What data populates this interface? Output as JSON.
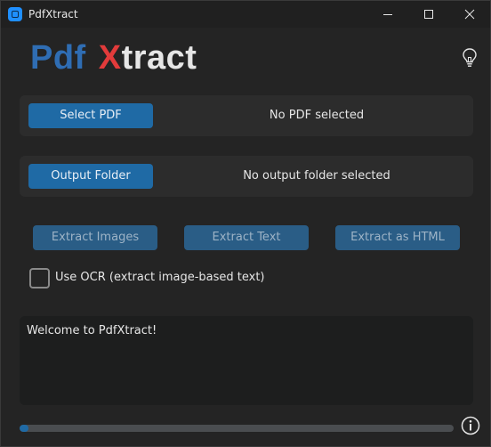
{
  "window": {
    "title": "PdfXtract"
  },
  "logo": {
    "part1": "Pdf",
    "part2": "X",
    "part3": "tract"
  },
  "pdf_row": {
    "button_label": "Select PDF",
    "status": "No PDF selected"
  },
  "output_row": {
    "button_label": "Output Folder",
    "status": "No output folder selected"
  },
  "actions": {
    "extract_images": "Extract Images",
    "extract_text": "Extract Text",
    "extract_html": "Extract as HTML"
  },
  "ocr": {
    "label": "Use OCR (extract image-based text)",
    "checked": false
  },
  "log": {
    "text": "Welcome to PdfXtract!"
  },
  "progress": {
    "value": 0.02
  },
  "icons": {
    "app": "app-icon",
    "theme": "lightbulb-icon",
    "about": "info-icon"
  },
  "colors": {
    "accent": "#1f6aa5",
    "logo_pdf": "#2f6db3",
    "logo_x": "#e23b3b",
    "background": "#242424"
  }
}
